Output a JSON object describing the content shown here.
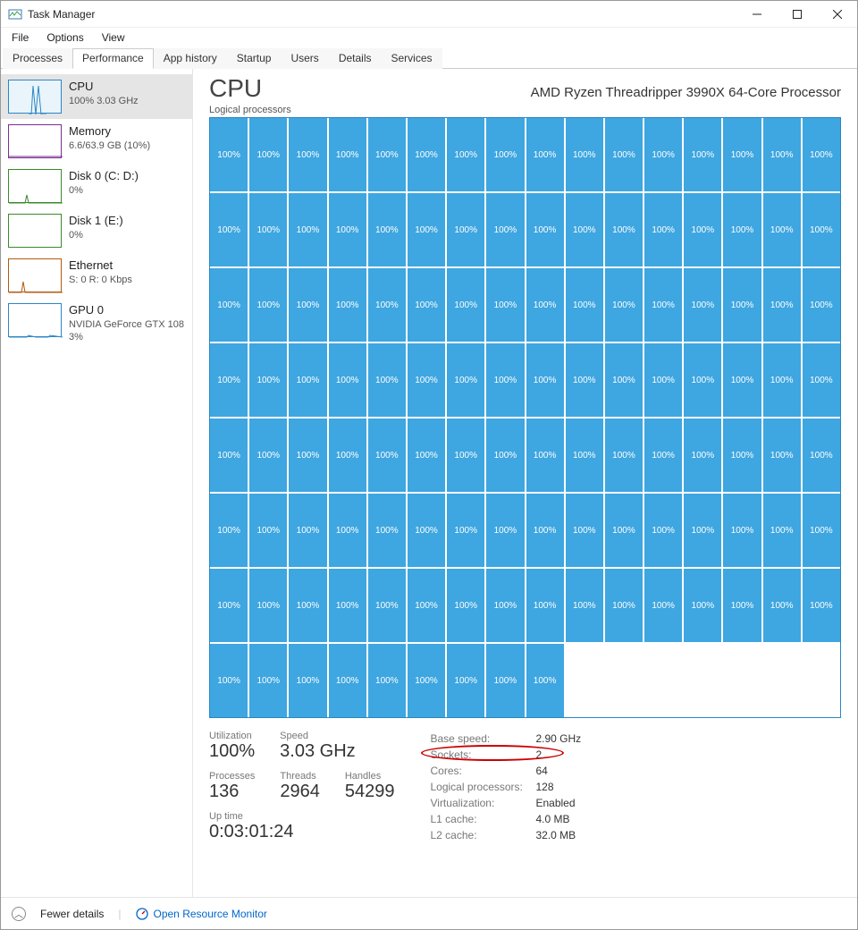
{
  "window": {
    "title": "Task Manager"
  },
  "menu": {
    "file": "File",
    "options": "Options",
    "view": "View"
  },
  "tabs": {
    "items": [
      {
        "label": "Processes"
      },
      {
        "label": "Performance"
      },
      {
        "label": "App history"
      },
      {
        "label": "Startup"
      },
      {
        "label": "Users"
      },
      {
        "label": "Details"
      },
      {
        "label": "Services"
      }
    ],
    "active": 1
  },
  "sidebar": [
    {
      "id": "cpu",
      "title": "CPU",
      "sub": "100% 3.03 GHz",
      "selected": true,
      "color": "#2a87c5"
    },
    {
      "id": "memory",
      "title": "Memory",
      "sub": "6.6/63.9 GB (10%)",
      "color": "#7a2f8f"
    },
    {
      "id": "disk0",
      "title": "Disk 0 (C: D:)",
      "sub": "0%",
      "color": "#3a8a2b"
    },
    {
      "id": "disk1",
      "title": "Disk 1 (E:)",
      "sub": "0%",
      "color": "#3a8a2b"
    },
    {
      "id": "ethernet",
      "title": "Ethernet",
      "sub": "S: 0 R: 0 Kbps",
      "color": "#b05a0f"
    },
    {
      "id": "gpu0",
      "title": "GPU 0",
      "sub": "NVIDIA GeForce GTX 108",
      "sub2": "3%",
      "color": "#2a87c5"
    }
  ],
  "cpu": {
    "heading": "CPU",
    "model": "AMD Ryzen Threadripper 3990X 64-Core Processor",
    "graph_label": "Logical processors",
    "core_count": 128,
    "core_value": "100%",
    "stats": {
      "utilization": {
        "label": "Utilization",
        "value": "100%"
      },
      "speed": {
        "label": "Speed",
        "value": "3.03 GHz"
      },
      "processes": {
        "label": "Processes",
        "value": "136"
      },
      "threads": {
        "label": "Threads",
        "value": "2964"
      },
      "handles": {
        "label": "Handles",
        "value": "54299"
      },
      "uptime": {
        "label": "Up time",
        "value": "0:03:01:24"
      }
    },
    "details": [
      {
        "k": "Base speed:",
        "v": "2.90 GHz"
      },
      {
        "k": "Sockets:",
        "v": "2",
        "highlight": true
      },
      {
        "k": "Cores:",
        "v": "64"
      },
      {
        "k": "Logical processors:",
        "v": "128"
      },
      {
        "k": "Virtualization:",
        "v": "Enabled"
      },
      {
        "k": "L1 cache:",
        "v": "4.0 MB"
      },
      {
        "k": "L2 cache:",
        "v": "32.0 MB"
      }
    ]
  },
  "footer": {
    "fewer": "Fewer details",
    "resmon": "Open Resource Monitor"
  }
}
